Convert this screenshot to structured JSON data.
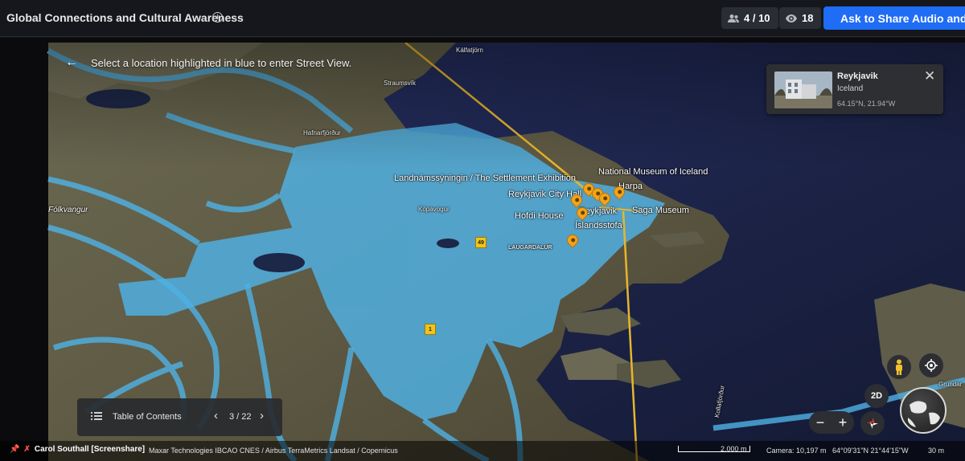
{
  "header": {
    "title": "Global Connections and Cultural Awareness",
    "participants": "4 / 10",
    "viewers": "18",
    "share_button": "Ask to Share Audio and Video"
  },
  "streetview_hint": "Select a location highlighted in blue to enter Street View.",
  "place_card": {
    "name": "Reykjavik",
    "country": "Iceland",
    "coords": "64.15°N, 21.94°W"
  },
  "map_labels": {
    "kalfatjorn": "Kálfatjörn",
    "straumsvik": "Straumsvík",
    "hafnarfjordur": "Hafnarfjörður",
    "folkvangur": "Fólkvangur",
    "kopavogur": "Kópavogur",
    "laugardalur": "LAUGARDALUR",
    "settlement": "Landnámssýningin / The Settlement Exhibition",
    "national_museum": "National Museum of Iceland",
    "city_hall": "Reykjavik City Hall",
    "harpa": "Harpa",
    "hofdi": "Hofdi House",
    "reykjavik": "Reykjavik",
    "saga_museum": "Saga Museum",
    "islandsstofa": "Íslandsstofa",
    "grundar": "Grundar",
    "kollafjordur": "Kollafjörður"
  },
  "road_shields": {
    "r49": "49",
    "r1": "1"
  },
  "toc": {
    "label": "Table of Contents",
    "page": "3 / 22"
  },
  "controls": {
    "mode_2d": "2D",
    "zoom_out": "−",
    "zoom_in": "+"
  },
  "status": {
    "presenter": "Carol Southall [Screenshare]",
    "attribution": "Maxar Technologies  IBCAO  CNES / Airbus  TerraMetrics  Landsat / Copernicus",
    "scale": "2,000 m",
    "camera": "Camera: 10,197 m",
    "position": "64°09'31\"N 21°44'15\"W",
    "elevation": "30 m"
  },
  "colors": {
    "accent": "#1f6cf5",
    "water": "#1b2345",
    "coverage": "#4fb2e6",
    "pin": "#f2a51a"
  }
}
